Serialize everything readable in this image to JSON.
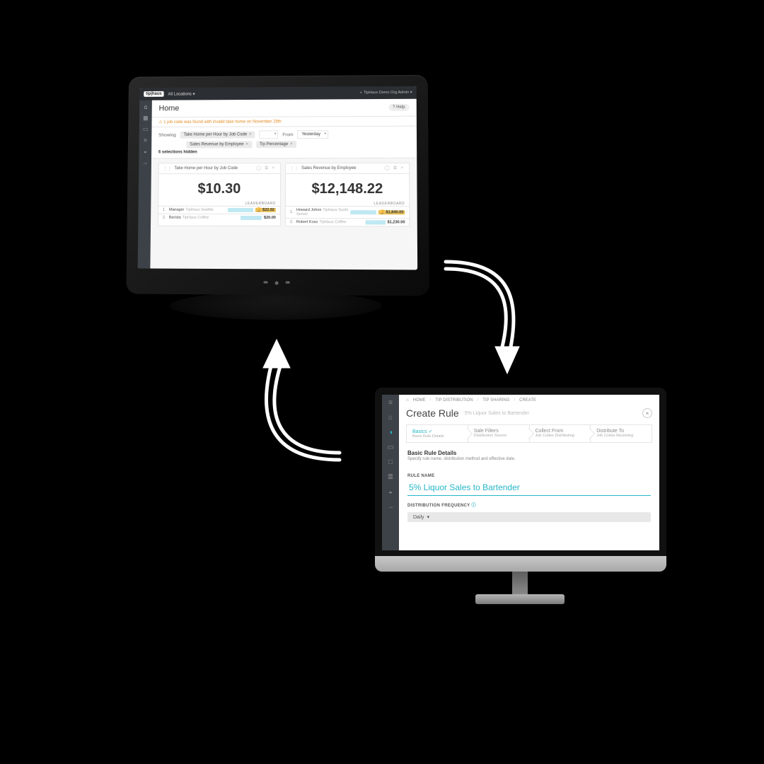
{
  "device1": {
    "topbar": {
      "logo": "tip|haus",
      "locations_label": "All Locations",
      "user_label": "TipHaus Demo Org Admin"
    },
    "sidebar_icons": [
      "home",
      "grid",
      "doc",
      "list",
      "user",
      "arrow"
    ],
    "page_title": "Home",
    "help_label": "? Help",
    "warning": "1 job code was found with invalid take home on November 29th",
    "filters": {
      "showing_label": "Showing",
      "chips": [
        "Take Home per Hour by Job Code",
        "Sales Revenue by Employee",
        "Tip Percentage"
      ],
      "hidden_note": "6 selections hidden",
      "from_label": "From",
      "from_value": "Yesterday"
    },
    "cards": [
      {
        "title": "Take Home per Hour by Job Code",
        "value": "$10.30",
        "leaderboard_label": "LEADERBOARD",
        "rows": [
          {
            "rank": "1.",
            "name": "Manager",
            "sub": "TipHaus SeaWa",
            "value": "$22.92",
            "gold": true
          },
          {
            "rank": "2.",
            "name": "Barista",
            "sub": "TipHaus Coffee",
            "value": "$20.00",
            "gold": false
          }
        ]
      },
      {
        "title": "Sales Revenue by Employee",
        "value": "$12,148.22",
        "leaderboard_label": "LEADERBOARD",
        "rows": [
          {
            "rank": "1.",
            "name": "Howard Johns",
            "sub": "TipHaus Sushi Server",
            "value": "$1,840.00",
            "gold": true
          },
          {
            "rank": "2.",
            "name": "Robert Koss",
            "sub": "TipHaus Coffee",
            "value": "$1,230.00",
            "gold": false
          }
        ]
      }
    ]
  },
  "device2": {
    "breadcrumb": [
      "HOME",
      "TIP DISTRIBUTION",
      "TIP SHARING",
      "CREATE"
    ],
    "page_title": "Create Rule",
    "page_subtitle": "5% Liquor Sales to Bartender",
    "wizard": [
      {
        "title": "Basics",
        "sub": "Basic Rule Details",
        "active": true
      },
      {
        "title": "Sale Filters",
        "sub": "Distribution Source",
        "active": false
      },
      {
        "title": "Collect From",
        "sub": "Job Codes Distributing",
        "active": false
      },
      {
        "title": "Distribute To",
        "sub": "Job Codes Receiving",
        "active": false
      }
    ],
    "section": {
      "heading": "Basic Rule Details",
      "desc": "Specify rule name, distribution method and effective date."
    },
    "rule_name_label": "RULE NAME",
    "rule_name_value": "5% Liquor Sales to Bartender",
    "dist_freq_label": "DISTRIBUTION FREQUENCY",
    "dist_freq_value": "Daily"
  }
}
